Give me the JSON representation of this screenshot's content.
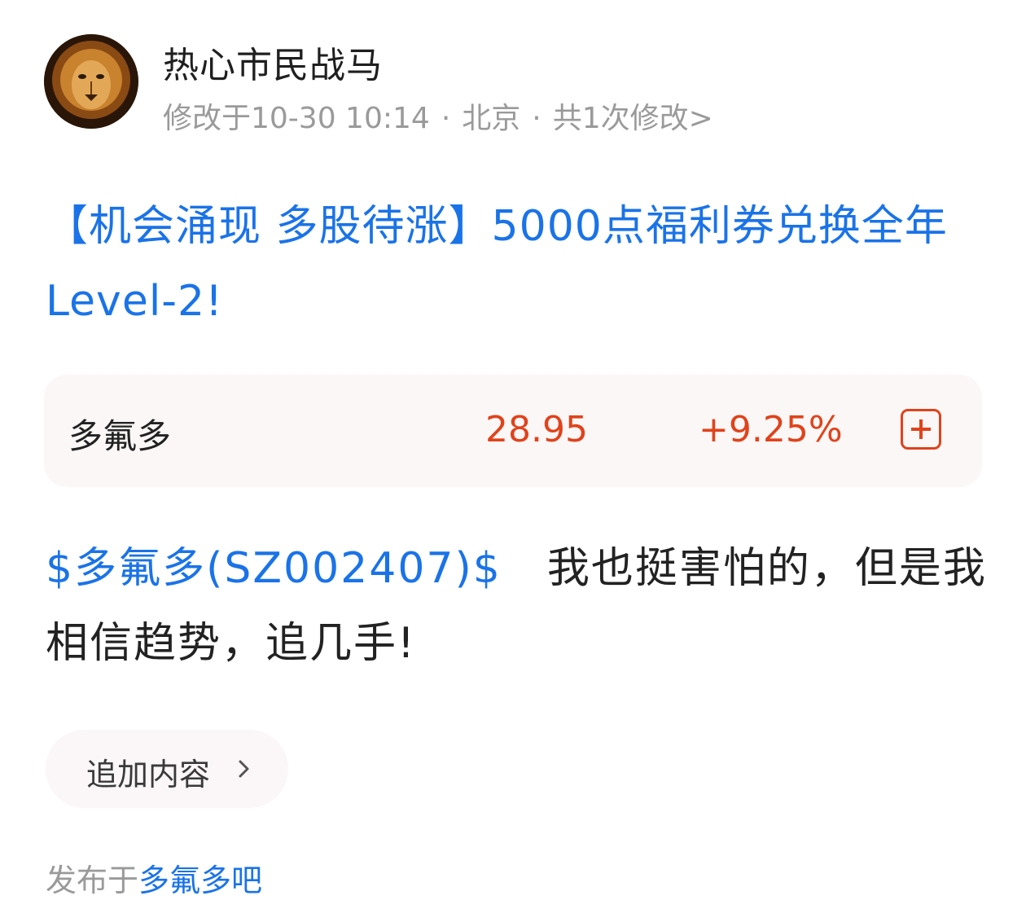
{
  "author": {
    "name": "热心市民战马",
    "avatar_icon": "lion-avatar"
  },
  "meta": {
    "modified": "修改于10-30 10:14",
    "location": "北京",
    "edit_count": "共1次修改>"
  },
  "title": "【机会涌现 多股待涨】5000点福利券兑换全年Level-2!",
  "stock_card": {
    "name": "多氟多",
    "price": "28.95",
    "change": "+9.25%",
    "add_icon": "plus-square-icon"
  },
  "post": {
    "stock_tag": "$多氟多(SZ002407)$",
    "text": "我也挺害怕的，但是我相信趋势，追几手!"
  },
  "append_button": {
    "label": "追加内容"
  },
  "published": {
    "prefix": "发布于",
    "forum": "多氟多吧"
  },
  "colors": {
    "link_blue": "#1a73e8",
    "stock_red": "#e0431b",
    "meta_gray": "#9a9a9a"
  }
}
